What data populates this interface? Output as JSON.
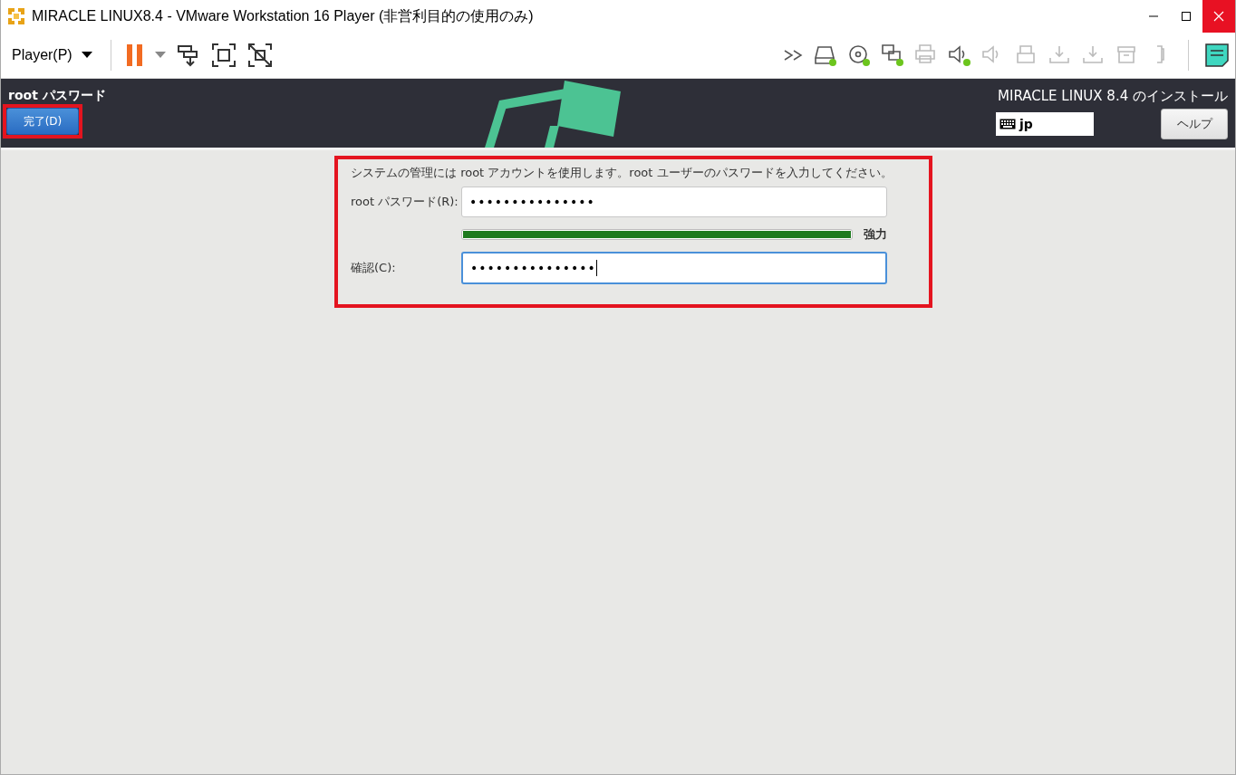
{
  "window": {
    "title": "MIRACLE LINUX8.4 - VMware Workstation 16 Player (非営利目的の使用のみ)"
  },
  "toolbar": {
    "player_menu": "Player(P)",
    "paused": true,
    "devices": [
      {
        "kind": "disk",
        "connected": true
      },
      {
        "kind": "cd",
        "connected": true
      },
      {
        "kind": "network",
        "connected": true
      },
      {
        "kind": "printer",
        "connected": false
      },
      {
        "kind": "sound",
        "connected": true
      },
      {
        "kind": "speaker",
        "connected": false
      },
      {
        "kind": "usb",
        "connected": false
      },
      {
        "kind": "import",
        "connected": false
      },
      {
        "kind": "import",
        "connected": false
      },
      {
        "kind": "archive",
        "connected": false
      },
      {
        "kind": "bracket",
        "connected": false
      }
    ]
  },
  "installer": {
    "spoke_title": "root パスワード",
    "done_button": {
      "label": "完了(D)",
      "highlighted": true
    },
    "product_title": "MIRACLE LINUX 8.4 のインストール",
    "keyboard_layout": "jp",
    "help_button": "ヘルプ"
  },
  "form": {
    "highlighted": true,
    "description": "システムの管理には root アカウントを使用します。root ユーザーのパスワードを入力してください。",
    "fields": [
      {
        "label": "root パスワード(R):",
        "value": "•••••••••••••••",
        "focused": false
      },
      {
        "label": "確認(C):",
        "value": "•••••••••••••••",
        "focused": true
      }
    ],
    "strength": {
      "level": 1.0,
      "label": "強力"
    }
  }
}
